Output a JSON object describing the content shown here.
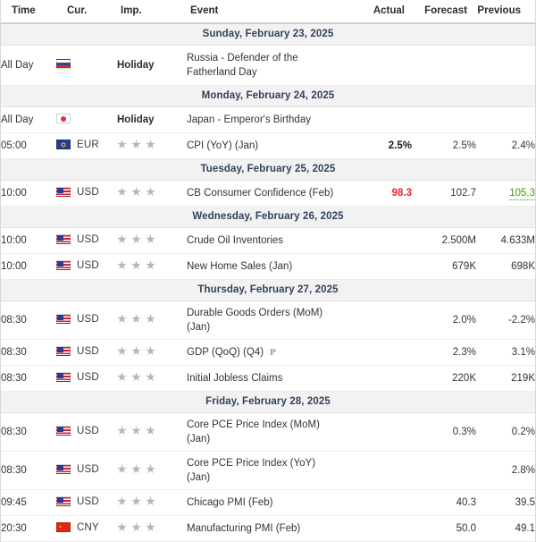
{
  "table": {
    "headers": {
      "time": "Time",
      "currency": "Cur.",
      "importance": "Imp.",
      "event": "Event",
      "actual": "Actual",
      "forecast": "Forecast",
      "previous": "Previous"
    },
    "colors": {
      "day_header_bg": "#f2f2f2",
      "day_header_text": "#33415c",
      "negative_value": "#e32636",
      "positive_value": "#37a000",
      "star": "#b6b6b6",
      "row_border": "#ececec"
    },
    "groups": [
      {
        "day": "Sunday, February 23, 2025",
        "rows": [
          {
            "time": "All Day",
            "flag": "flag-ru",
            "currency": "",
            "importance_label": "Holiday",
            "stars": 0,
            "event": "Russia - Defender of the Fatherland Day",
            "event_line2": "",
            "prelim": "",
            "actual": "",
            "actual_style": "",
            "forecast": "",
            "previous": "",
            "previous_style": ""
          }
        ]
      },
      {
        "day": "Monday, February 24, 2025",
        "rows": [
          {
            "time": "All Day",
            "flag": "flag-jp",
            "currency": "",
            "importance_label": "Holiday",
            "stars": 0,
            "event": "Japan - Emperor's Birthday",
            "event_line2": "",
            "prelim": "",
            "actual": "",
            "actual_style": "",
            "forecast": "",
            "previous": "",
            "previous_style": ""
          },
          {
            "time": "05:00",
            "flag": "flag-eu",
            "currency": "EUR",
            "importance_label": "",
            "stars": 3,
            "event": "CPI (YoY) (Jan)",
            "event_line2": "",
            "prelim": "",
            "actual": "2.5%",
            "actual_style": "val-bold",
            "forecast": "2.5%",
            "previous": "2.4%",
            "previous_style": ""
          }
        ]
      },
      {
        "day": "Tuesday, February 25, 2025",
        "rows": [
          {
            "time": "10:00",
            "flag": "flag-us",
            "currency": "USD",
            "importance_label": "",
            "stars": 3,
            "event": "CB Consumer Confidence (Feb)",
            "event_line2": "",
            "prelim": "",
            "actual": "98.3",
            "actual_style": "val-red",
            "forecast": "102.7",
            "previous": "105.3",
            "previous_style": "val-green-underline"
          }
        ]
      },
      {
        "day": "Wednesday, February 26, 2025",
        "rows": [
          {
            "time": "10:00",
            "flag": "flag-us",
            "currency": "USD",
            "importance_label": "",
            "stars": 3,
            "event": "Crude Oil Inventories",
            "event_line2": "",
            "prelim": "",
            "actual": "",
            "actual_style": "",
            "forecast": "2.500M",
            "previous": "4.633M",
            "previous_style": ""
          },
          {
            "time": "10:00",
            "flag": "flag-us",
            "currency": "USD",
            "importance_label": "",
            "stars": 3,
            "event": "New Home Sales (Jan)",
            "event_line2": "",
            "prelim": "",
            "actual": "",
            "actual_style": "",
            "forecast": "679K",
            "previous": "698K",
            "previous_style": ""
          }
        ]
      },
      {
        "day": "Thursday, February 27, 2025",
        "rows": [
          {
            "time": "08:30",
            "flag": "flag-us",
            "currency": "USD",
            "importance_label": "",
            "stars": 3,
            "event": "Durable Goods Orders (MoM)",
            "event_line2": "(Jan)",
            "prelim": "",
            "actual": "",
            "actual_style": "",
            "forecast": "2.0%",
            "previous": "-2.2%",
            "previous_style": ""
          },
          {
            "time": "08:30",
            "flag": "flag-us",
            "currency": "USD",
            "importance_label": "",
            "stars": 3,
            "event": "GDP (QoQ) (Q4)",
            "event_line2": "",
            "prelim": "P",
            "actual": "",
            "actual_style": "",
            "forecast": "2.3%",
            "previous": "3.1%",
            "previous_style": ""
          },
          {
            "time": "08:30",
            "flag": "flag-us",
            "currency": "USD",
            "importance_label": "",
            "stars": 3,
            "event": "Initial Jobless Claims",
            "event_line2": "",
            "prelim": "",
            "actual": "",
            "actual_style": "",
            "forecast": "220K",
            "previous": "219K",
            "previous_style": ""
          }
        ]
      },
      {
        "day": "Friday, February 28, 2025",
        "rows": [
          {
            "time": "08:30",
            "flag": "flag-us",
            "currency": "USD",
            "importance_label": "",
            "stars": 3,
            "event": "Core PCE Price Index (MoM)",
            "event_line2": "(Jan)",
            "prelim": "",
            "actual": "",
            "actual_style": "",
            "forecast": "0.3%",
            "previous": "0.2%",
            "previous_style": ""
          },
          {
            "time": "08:30",
            "flag": "flag-us",
            "currency": "USD",
            "importance_label": "",
            "stars": 3,
            "event": "Core PCE Price Index (YoY)",
            "event_line2": "(Jan)",
            "prelim": "",
            "actual": "",
            "actual_style": "",
            "forecast": "",
            "previous": "2.8%",
            "previous_style": ""
          },
          {
            "time": "09:45",
            "flag": "flag-us",
            "currency": "USD",
            "importance_label": "",
            "stars": 3,
            "event": "Chicago PMI (Feb)",
            "event_line2": "",
            "prelim": "",
            "actual": "",
            "actual_style": "",
            "forecast": "40.3",
            "previous": "39.5",
            "previous_style": ""
          },
          {
            "time": "20:30",
            "flag": "flag-cn",
            "currency": "CNY",
            "importance_label": "",
            "stars": 3,
            "event": "Manufacturing PMI (Feb)",
            "event_line2": "",
            "prelim": "",
            "actual": "",
            "actual_style": "",
            "forecast": "50.0",
            "previous": "49.1",
            "previous_style": ""
          }
        ]
      }
    ]
  }
}
